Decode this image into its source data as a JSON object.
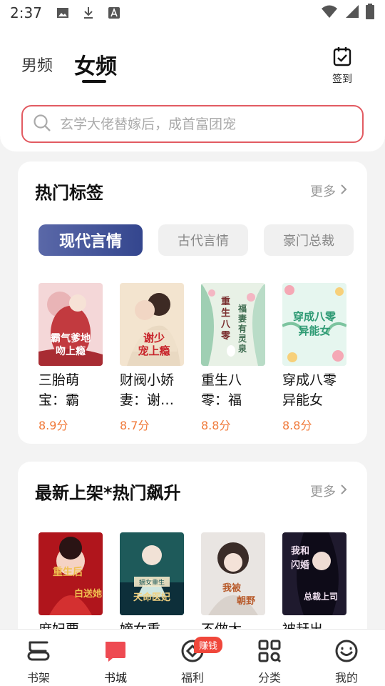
{
  "status_bar": {
    "time": "2:37",
    "icons": [
      "image-icon",
      "download-icon",
      "a-icon",
      "wifi-icon",
      "signal-icon",
      "battery-icon"
    ]
  },
  "header": {
    "tabs": [
      {
        "label": "男频",
        "active": false
      },
      {
        "label": "女频",
        "active": true
      }
    ],
    "signin_label": "签到",
    "search_placeholder": "玄学大佬替嫁后，成首富团宠"
  },
  "hot_tags": {
    "title": "热门标签",
    "more_label": "更多",
    "tags": [
      {
        "label": "现代言情",
        "active": true
      },
      {
        "label": "古代言情",
        "active": false
      },
      {
        "label": "豪门总裁",
        "active": false
      }
    ],
    "books": [
      {
        "title": "三胎萌宝：霸气…",
        "score": "8.9分",
        "cover_text": "霸气爹地吻上瘾",
        "cover_colors": [
          "#f4d7d8",
          "#c23a3f"
        ]
      },
      {
        "title": "财阀小娇妻：谢…",
        "score": "8.7分",
        "cover_text": "谢少宠上瘾",
        "cover_colors": [
          "#f3e4cf",
          "#9a6b4f"
        ]
      },
      {
        "title": "重生八零：福妻…",
        "score": "8.8分",
        "cover_text": "重生八零福妻有灵泉",
        "cover_colors": [
          "#e8f1e6",
          "#6fae8f"
        ]
      },
      {
        "title": "穿成八零异能女",
        "score": "8.8分",
        "cover_text": "穿成八零异能女",
        "cover_colors": [
          "#e6f6ef",
          "#6dc0a0"
        ]
      }
    ]
  },
  "new_hot": {
    "title": "最新上架*热门飙升",
    "more_label": "更多",
    "books": [
      {
        "title": "庶妃要我…",
        "cover_text": "重生后我白送她",
        "cover_colors": [
          "#b0151c",
          "#f0b040"
        ]
      },
      {
        "title": "嫡女重生…",
        "cover_text": "嫡女重生天命医妃",
        "cover_colors": [
          "#1e5a5a",
          "#0d2f3a"
        ]
      },
      {
        "title": "不做太子…",
        "cover_text": "我被朝野娶妃",
        "cover_colors": [
          "#e9e5e2",
          "#5a4a44"
        ]
      },
      {
        "title": "被赶出娘…",
        "cover_text": "我和闪婚总裁上司",
        "cover_colors": [
          "#1f1a2e",
          "#3a2f5a"
        ]
      }
    ]
  },
  "tabbar": {
    "items": [
      {
        "label": "书架",
        "active": false
      },
      {
        "label": "书城",
        "active": true
      },
      {
        "label": "福利",
        "active": false,
        "badge": "赚钱"
      },
      {
        "label": "分类",
        "active": false
      },
      {
        "label": "我的",
        "active": false
      }
    ]
  },
  "colors": {
    "accent_red": "#e25b62",
    "score_orange": "#f07a3a",
    "active_tag_blue": "#3c4c92"
  }
}
